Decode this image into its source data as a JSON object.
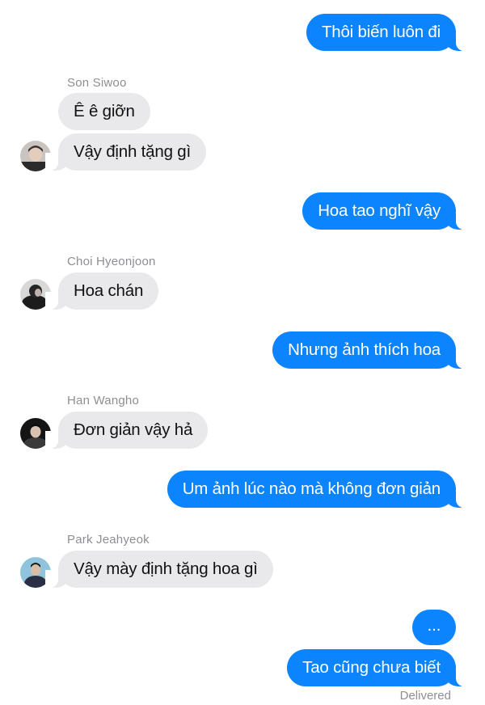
{
  "messages": [
    {
      "text": "Thôi biến luôn đi"
    },
    {
      "sender": "Son Siwoo",
      "text": "Ê ê giỡn"
    },
    {
      "text": "Vậy định tặng gì"
    },
    {
      "text": "Hoa tao nghĩ vậy"
    },
    {
      "sender": "Choi Hyeonjoon",
      "text": "Hoa chán"
    },
    {
      "text": "Nhưng ảnh thích hoa"
    },
    {
      "sender": "Han Wangho",
      "text": "Đơn giản vậy hả"
    },
    {
      "text": "Um ảnh lúc nào mà không đơn giản"
    },
    {
      "sender": "Park Jeahyeok",
      "text": "Vậy mày định tặng hoa gì"
    },
    {
      "text": "..."
    },
    {
      "text": "Tao cũng chưa biết"
    }
  ],
  "status": "Delivered",
  "colors": {
    "sent_bubble": "#0b84fe",
    "received_bubble": "#e9e9eb",
    "meta_text": "#8e8e93"
  },
  "icons": {
    "avatar": "contact-avatar-icon"
  }
}
